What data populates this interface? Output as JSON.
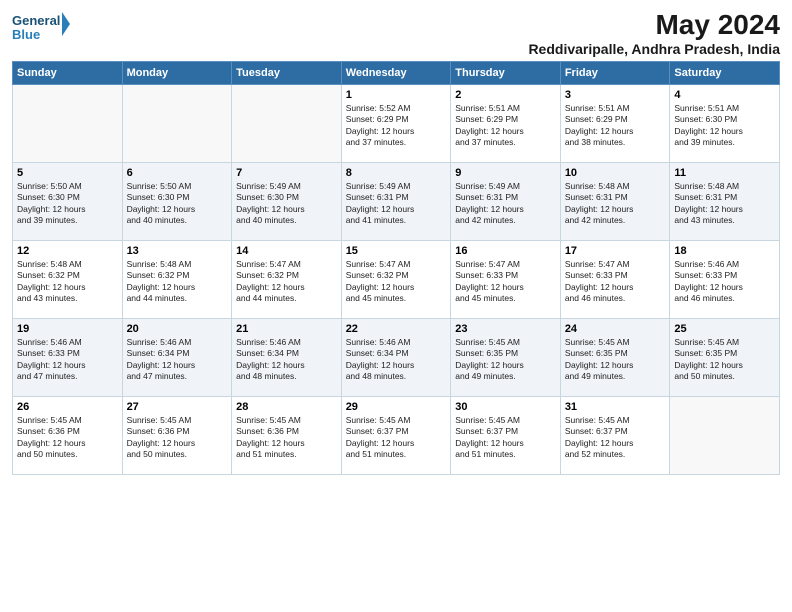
{
  "logo": {
    "line1": "General",
    "line2": "Blue"
  },
  "title": "May 2024",
  "subtitle": "Reddivaripalle, Andhra Pradesh, India",
  "days_of_week": [
    "Sunday",
    "Monday",
    "Tuesday",
    "Wednesday",
    "Thursday",
    "Friday",
    "Saturday"
  ],
  "weeks": [
    [
      {
        "day": "",
        "info": ""
      },
      {
        "day": "",
        "info": ""
      },
      {
        "day": "",
        "info": ""
      },
      {
        "day": "1",
        "info": "Sunrise: 5:52 AM\nSunset: 6:29 PM\nDaylight: 12 hours\nand 37 minutes."
      },
      {
        "day": "2",
        "info": "Sunrise: 5:51 AM\nSunset: 6:29 PM\nDaylight: 12 hours\nand 37 minutes."
      },
      {
        "day": "3",
        "info": "Sunrise: 5:51 AM\nSunset: 6:29 PM\nDaylight: 12 hours\nand 38 minutes."
      },
      {
        "day": "4",
        "info": "Sunrise: 5:51 AM\nSunset: 6:30 PM\nDaylight: 12 hours\nand 39 minutes."
      }
    ],
    [
      {
        "day": "5",
        "info": "Sunrise: 5:50 AM\nSunset: 6:30 PM\nDaylight: 12 hours\nand 39 minutes."
      },
      {
        "day": "6",
        "info": "Sunrise: 5:50 AM\nSunset: 6:30 PM\nDaylight: 12 hours\nand 40 minutes."
      },
      {
        "day": "7",
        "info": "Sunrise: 5:49 AM\nSunset: 6:30 PM\nDaylight: 12 hours\nand 40 minutes."
      },
      {
        "day": "8",
        "info": "Sunrise: 5:49 AM\nSunset: 6:31 PM\nDaylight: 12 hours\nand 41 minutes."
      },
      {
        "day": "9",
        "info": "Sunrise: 5:49 AM\nSunset: 6:31 PM\nDaylight: 12 hours\nand 42 minutes."
      },
      {
        "day": "10",
        "info": "Sunrise: 5:48 AM\nSunset: 6:31 PM\nDaylight: 12 hours\nand 42 minutes."
      },
      {
        "day": "11",
        "info": "Sunrise: 5:48 AM\nSunset: 6:31 PM\nDaylight: 12 hours\nand 43 minutes."
      }
    ],
    [
      {
        "day": "12",
        "info": "Sunrise: 5:48 AM\nSunset: 6:32 PM\nDaylight: 12 hours\nand 43 minutes."
      },
      {
        "day": "13",
        "info": "Sunrise: 5:48 AM\nSunset: 6:32 PM\nDaylight: 12 hours\nand 44 minutes."
      },
      {
        "day": "14",
        "info": "Sunrise: 5:47 AM\nSunset: 6:32 PM\nDaylight: 12 hours\nand 44 minutes."
      },
      {
        "day": "15",
        "info": "Sunrise: 5:47 AM\nSunset: 6:32 PM\nDaylight: 12 hours\nand 45 minutes."
      },
      {
        "day": "16",
        "info": "Sunrise: 5:47 AM\nSunset: 6:33 PM\nDaylight: 12 hours\nand 45 minutes."
      },
      {
        "day": "17",
        "info": "Sunrise: 5:47 AM\nSunset: 6:33 PM\nDaylight: 12 hours\nand 46 minutes."
      },
      {
        "day": "18",
        "info": "Sunrise: 5:46 AM\nSunset: 6:33 PM\nDaylight: 12 hours\nand 46 minutes."
      }
    ],
    [
      {
        "day": "19",
        "info": "Sunrise: 5:46 AM\nSunset: 6:33 PM\nDaylight: 12 hours\nand 47 minutes."
      },
      {
        "day": "20",
        "info": "Sunrise: 5:46 AM\nSunset: 6:34 PM\nDaylight: 12 hours\nand 47 minutes."
      },
      {
        "day": "21",
        "info": "Sunrise: 5:46 AM\nSunset: 6:34 PM\nDaylight: 12 hours\nand 48 minutes."
      },
      {
        "day": "22",
        "info": "Sunrise: 5:46 AM\nSunset: 6:34 PM\nDaylight: 12 hours\nand 48 minutes."
      },
      {
        "day": "23",
        "info": "Sunrise: 5:45 AM\nSunset: 6:35 PM\nDaylight: 12 hours\nand 49 minutes."
      },
      {
        "day": "24",
        "info": "Sunrise: 5:45 AM\nSunset: 6:35 PM\nDaylight: 12 hours\nand 49 minutes."
      },
      {
        "day": "25",
        "info": "Sunrise: 5:45 AM\nSunset: 6:35 PM\nDaylight: 12 hours\nand 50 minutes."
      }
    ],
    [
      {
        "day": "26",
        "info": "Sunrise: 5:45 AM\nSunset: 6:36 PM\nDaylight: 12 hours\nand 50 minutes."
      },
      {
        "day": "27",
        "info": "Sunrise: 5:45 AM\nSunset: 6:36 PM\nDaylight: 12 hours\nand 50 minutes."
      },
      {
        "day": "28",
        "info": "Sunrise: 5:45 AM\nSunset: 6:36 PM\nDaylight: 12 hours\nand 51 minutes."
      },
      {
        "day": "29",
        "info": "Sunrise: 5:45 AM\nSunset: 6:37 PM\nDaylight: 12 hours\nand 51 minutes."
      },
      {
        "day": "30",
        "info": "Sunrise: 5:45 AM\nSunset: 6:37 PM\nDaylight: 12 hours\nand 51 minutes."
      },
      {
        "day": "31",
        "info": "Sunrise: 5:45 AM\nSunset: 6:37 PM\nDaylight: 12 hours\nand 52 minutes."
      },
      {
        "day": "",
        "info": ""
      }
    ]
  ]
}
